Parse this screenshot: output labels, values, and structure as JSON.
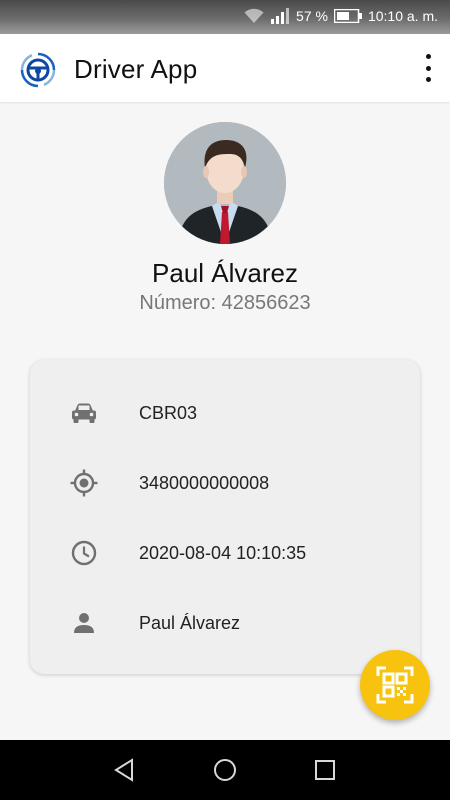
{
  "status_bar": {
    "battery": "57 %",
    "time": "10:10 a. m."
  },
  "app_bar": {
    "title": "Driver App",
    "logo_icon": "steering-wheel-icon",
    "menu_icon": "more-vert-icon"
  },
  "profile": {
    "name": "Paul Álvarez",
    "number": "Número: 42856623",
    "avatar_icon": "man-in-suit-avatar"
  },
  "info": {
    "vehicle": "CBR03",
    "device_id": "3480000000008",
    "datetime": "2020-08-04 10:10:35",
    "driver": "Paul Álvarez"
  },
  "fab": {
    "icon": "qr-scan-icon"
  },
  "colors": {
    "accent": "#f7c30f",
    "brand_blue": "#1565c0",
    "icon_gray": "#707070"
  }
}
